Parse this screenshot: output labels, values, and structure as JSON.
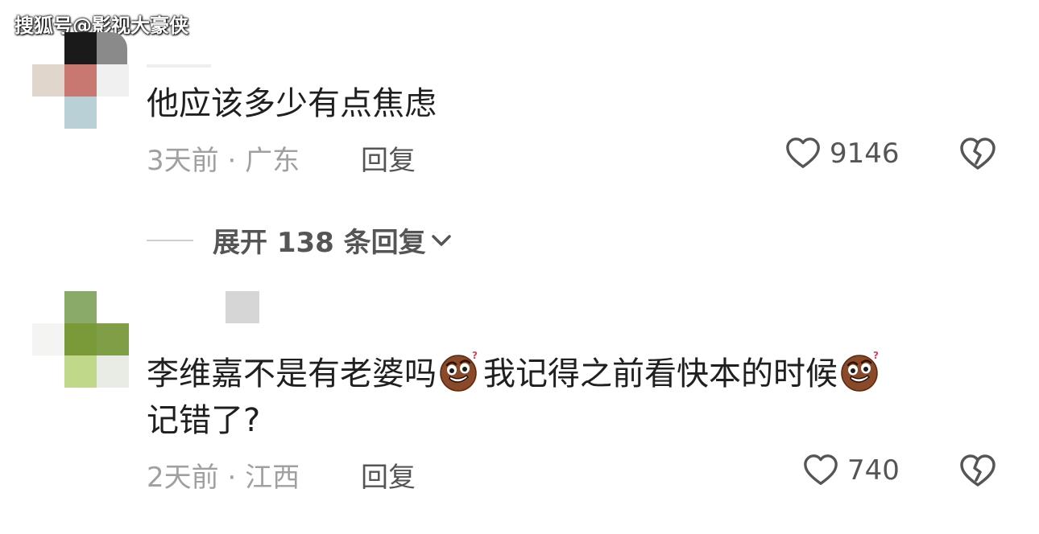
{
  "watermark": "搜狐号@影视大豪侠",
  "comments": [
    {
      "text": "他应该多少有点焦虑",
      "time": "3天前",
      "separator": "·",
      "location": "广东",
      "reply_label": "回复",
      "likes": "9146",
      "avatar_colors": [
        "#1a1a1a",
        "#c87870",
        "#e0d6cc",
        "#b8d0d6",
        "#8a8a8a"
      ],
      "icons": {
        "like": "heart-outline-icon",
        "dislike": "broken-heart-icon"
      }
    },
    {
      "text_part1": "李维嘉不是有老婆吗",
      "text_part2": "我记得之前看快本的时候",
      "text_line2": "记错了?",
      "time": "2天前",
      "separator": "·",
      "location": "江西",
      "reply_label": "回复",
      "likes": "740",
      "avatar_colors": [
        "#8aaa6a",
        "#7a9a3a",
        "#c0d88a",
        "#e8ece4"
      ],
      "icons": {
        "emoji": "confused-face-emoji-icon",
        "like": "heart-outline-icon",
        "dislike": "broken-heart-icon"
      }
    }
  ],
  "expand_replies": {
    "label": "展开 138 条回复",
    "icon": "chevron-down-icon"
  },
  "colors": {
    "meta_text": "#a0a0a0",
    "action_text": "#555555",
    "body_text": "#1f1f1f"
  }
}
